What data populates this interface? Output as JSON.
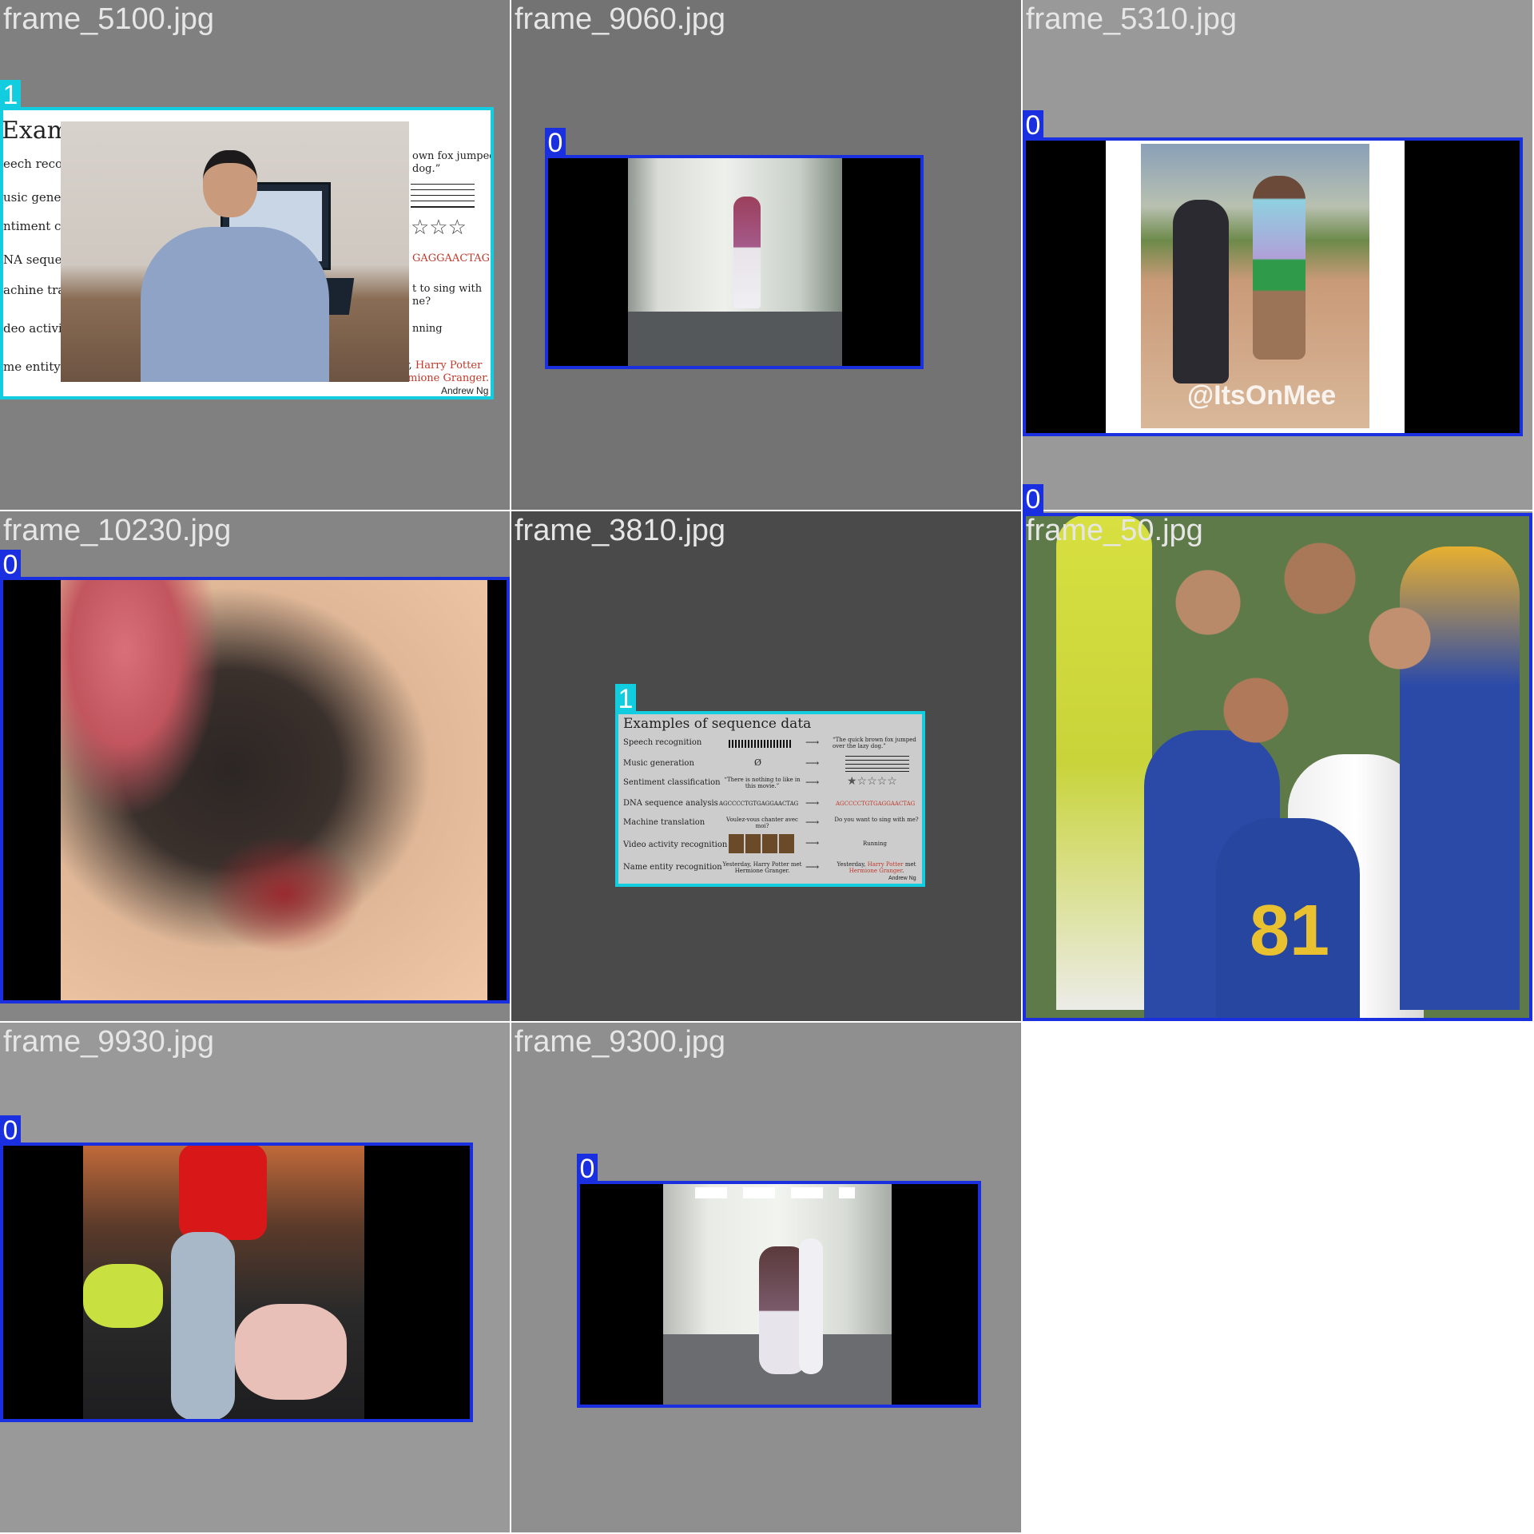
{
  "tiles": [
    {
      "filename": "frame_5100.jpg",
      "label": "1"
    },
    {
      "filename": "frame_9060.jpg",
      "label": "0"
    },
    {
      "filename": "frame_5310.jpg",
      "label": "0"
    },
    {
      "filename": "frame_10230.jpg",
      "label": "0"
    },
    {
      "filename": "frame_3810.jpg",
      "label": "1"
    },
    {
      "filename": "frame_50.jpg",
      "label": "0"
    },
    {
      "filename": "frame_9930.jpg",
      "label": "0"
    },
    {
      "filename": "frame_9300.jpg",
      "label": "0"
    }
  ],
  "slide_full": {
    "title": "Examples of sequence data",
    "rows": [
      {
        "task": "Speech recognition",
        "input": "",
        "output": "“The quick brown fox jumped over the lazy dog.”"
      },
      {
        "task": "Music generation",
        "input": "Ø",
        "output": ""
      },
      {
        "task": "Sentiment classification",
        "input": "“There is nothing to like in this movie.”",
        "output": "★☆☆☆☆"
      },
      {
        "task": "DNA sequence analysis",
        "input": "AGCCCCTGTGAGGAACTAG",
        "output": "AGCCCCTGTGAGGAACTAG"
      },
      {
        "task": "Machine translation",
        "input": "Voulez-vous chanter avec moi?",
        "output": "Do you want to sing with me?"
      },
      {
        "task": "Video activity recognition",
        "input": "",
        "output": "Running"
      },
      {
        "task": "Name entity recognition",
        "input": "Yesterday, Harry Potter met Hermione Granger.",
        "output_pre": "Yesterday, ",
        "output_red1": "Harry Potter",
        "output_mid": " met ",
        "output_red2": "Hermione Granger",
        "output_post": "."
      }
    ],
    "credit": "Andrew Ng"
  },
  "slide_crop": {
    "title_fragment": "Examp",
    "left_fragments": [
      "eech recog",
      "usic gener",
      "ntiment c",
      "NA sequer",
      "achine tra",
      "deo activit",
      "me entity"
    ],
    "right_fragments": [
      "own fox jumped",
      "dog.”",
      "☆☆☆",
      "GAGGAACTAG",
      "t to sing with",
      "ne?",
      "nning"
    ],
    "harry_pre": "y, ",
    "harry": "Harry Potter",
    "hermione": "mione Granger.",
    "credit": "Andrew Ng"
  },
  "watermark": "@ItsOnMee",
  "jersey_number": "81",
  "colors": {
    "box_class0": "#1a2fe0",
    "box_class1": "#12cde0",
    "filename_text": "#e6e6e6"
  }
}
